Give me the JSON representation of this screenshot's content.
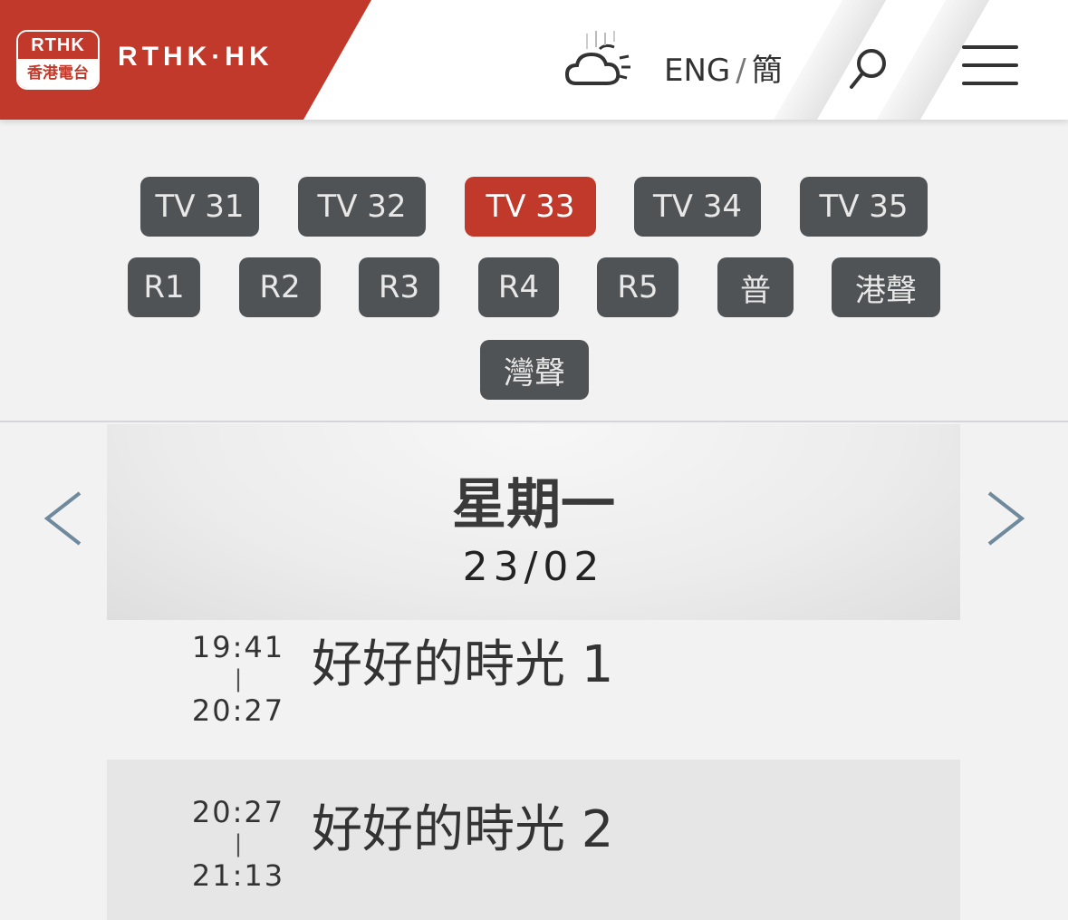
{
  "header": {
    "logo_top": "RTHK",
    "logo_bottom": "香港電台",
    "brand_name": "RTHK·HK",
    "weather_icon": "cloud-rain-icon",
    "lang_eng": "ENG",
    "lang_sep": "/",
    "lang_simplified": "簡",
    "search_icon": "search-icon",
    "menu_icon": "hamburger-menu-icon"
  },
  "channels": {
    "tv": [
      "TV 31",
      "TV 32",
      "TV 33",
      "TV 34",
      "TV 35"
    ],
    "radio": [
      "R1",
      "R2",
      "R3",
      "R4",
      "R5",
      "普",
      "港聲"
    ],
    "extra": [
      "灣聲"
    ],
    "active": "TV 33"
  },
  "date_nav": {
    "weekday": "星期一",
    "date": "23/02",
    "prev_icon": "chevron-left-icon",
    "next_icon": "chevron-right-icon"
  },
  "programmes": [
    {
      "start": "19:41",
      "end": "20:27",
      "separator": "|",
      "title": "好好的時光 1"
    },
    {
      "start": "20:27",
      "end": "21:13",
      "separator": "|",
      "title": "好好的時光 2"
    }
  ],
  "colors": {
    "brand_red": "#c0392b",
    "chip_grey": "#505355",
    "background": "#f2f2f2"
  }
}
